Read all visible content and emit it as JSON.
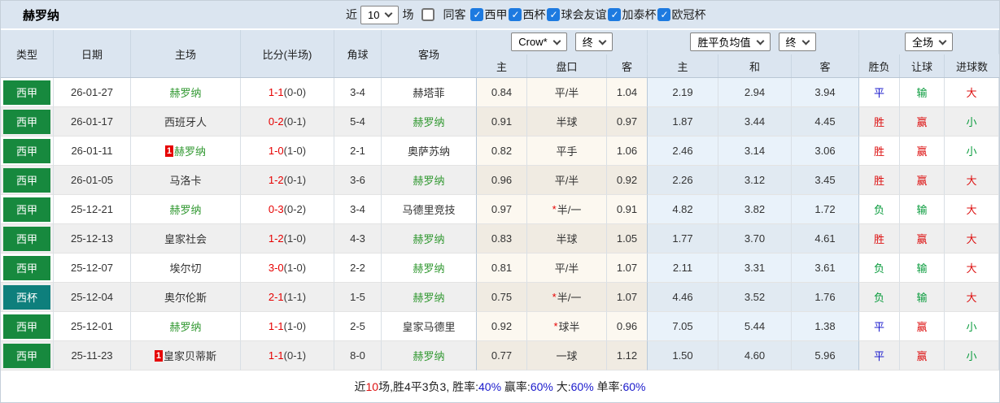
{
  "topbar": {
    "team": "赫罗纳",
    "near_label": "近",
    "games_value": "10",
    "games_unit": "场",
    "same_away": {
      "label": "同客",
      "checked": false
    },
    "filters": [
      {
        "label": "西甲",
        "checked": true
      },
      {
        "label": "西杯",
        "checked": true
      },
      {
        "label": "球会友谊",
        "checked": true
      },
      {
        "label": "加泰杯",
        "checked": true
      },
      {
        "label": "欧冠杯",
        "checked": true
      }
    ]
  },
  "selects": {
    "odds_company": "Crow*",
    "odds_stage": "终",
    "avg_label": "胜平负均值",
    "avg_stage": "终",
    "scope": "全场"
  },
  "columns": {
    "left": [
      "类型",
      "日期",
      "主场",
      "比分(半场)",
      "角球",
      "客场"
    ],
    "odds": [
      "主",
      "盘口",
      "客",
      "主",
      "和",
      "客",
      "胜负",
      "让球",
      "进球数"
    ]
  },
  "rows": [
    {
      "type": {
        "t": "西甲",
        "kind": "league"
      },
      "date": "26-01-27",
      "home": {
        "t": "赫罗纳",
        "green": true
      },
      "score": {
        "ft": "1-1",
        "ht": "(0-0)"
      },
      "corner": "3-4",
      "away": {
        "t": "赫塔菲",
        "green": false
      },
      "odds": {
        "home": "0.84",
        "star": false,
        "handicap": "平/半",
        "away": "1.04"
      },
      "avg": {
        "home": "2.19",
        "draw": "2.94",
        "away": "3.94"
      },
      "result": {
        "t": "平",
        "c": "blue"
      },
      "let": {
        "t": "输",
        "c": "green"
      },
      "goals": {
        "t": "大",
        "c": "red"
      }
    },
    {
      "type": {
        "t": "西甲",
        "kind": "league"
      },
      "date": "26-01-17",
      "home": {
        "t": "西班牙人",
        "green": false
      },
      "score": {
        "ft": "0-2",
        "ht": "(0-1)"
      },
      "corner": "5-4",
      "away": {
        "t": "赫罗纳",
        "green": true
      },
      "odds": {
        "home": "0.91",
        "star": false,
        "handicap": "半球",
        "away": "0.97"
      },
      "avg": {
        "home": "1.87",
        "draw": "3.44",
        "away": "4.45"
      },
      "result": {
        "t": "胜",
        "c": "red"
      },
      "let": {
        "t": "赢",
        "c": "red"
      },
      "goals": {
        "t": "小",
        "c": "green"
      }
    },
    {
      "type": {
        "t": "西甲",
        "kind": "league"
      },
      "date": "26-01-11",
      "home": {
        "t": "赫罗纳",
        "green": true,
        "badge": "1"
      },
      "score": {
        "ft": "1-0",
        "ht": "(1-0)"
      },
      "corner": "2-1",
      "away": {
        "t": "奥萨苏纳",
        "green": false
      },
      "odds": {
        "home": "0.82",
        "star": false,
        "handicap": "平手",
        "away": "1.06"
      },
      "avg": {
        "home": "2.46",
        "draw": "3.14",
        "away": "3.06"
      },
      "result": {
        "t": "胜",
        "c": "red"
      },
      "let": {
        "t": "赢",
        "c": "red"
      },
      "goals": {
        "t": "小",
        "c": "green"
      }
    },
    {
      "type": {
        "t": "西甲",
        "kind": "league"
      },
      "date": "26-01-05",
      "home": {
        "t": "马洛卡",
        "green": false
      },
      "score": {
        "ft": "1-2",
        "ht": "(0-1)"
      },
      "corner": "3-6",
      "away": {
        "t": "赫罗纳",
        "green": true
      },
      "odds": {
        "home": "0.96",
        "star": false,
        "handicap": "平/半",
        "away": "0.92"
      },
      "avg": {
        "home": "2.26",
        "draw": "3.12",
        "away": "3.45"
      },
      "result": {
        "t": "胜",
        "c": "red"
      },
      "let": {
        "t": "赢",
        "c": "red"
      },
      "goals": {
        "t": "大",
        "c": "red"
      }
    },
    {
      "type": {
        "t": "西甲",
        "kind": "league"
      },
      "date": "25-12-21",
      "home": {
        "t": "赫罗纳",
        "green": true
      },
      "score": {
        "ft": "0-3",
        "ht": "(0-2)"
      },
      "corner": "3-4",
      "away": {
        "t": "马德里竞技",
        "green": false
      },
      "odds": {
        "home": "0.97",
        "star": true,
        "handicap": "半/一",
        "away": "0.91"
      },
      "avg": {
        "home": "4.82",
        "draw": "3.82",
        "away": "1.72"
      },
      "result": {
        "t": "负",
        "c": "green"
      },
      "let": {
        "t": "输",
        "c": "green"
      },
      "goals": {
        "t": "大",
        "c": "red"
      }
    },
    {
      "type": {
        "t": "西甲",
        "kind": "league"
      },
      "date": "25-12-13",
      "home": {
        "t": "皇家社会",
        "green": false
      },
      "score": {
        "ft": "1-2",
        "ht": "(1-0)"
      },
      "corner": "4-3",
      "away": {
        "t": "赫罗纳",
        "green": true
      },
      "odds": {
        "home": "0.83",
        "star": false,
        "handicap": "半球",
        "away": "1.05"
      },
      "avg": {
        "home": "1.77",
        "draw": "3.70",
        "away": "4.61"
      },
      "result": {
        "t": "胜",
        "c": "red"
      },
      "let": {
        "t": "赢",
        "c": "red"
      },
      "goals": {
        "t": "大",
        "c": "red"
      }
    },
    {
      "type": {
        "t": "西甲",
        "kind": "league"
      },
      "date": "25-12-07",
      "home": {
        "t": "埃尔切",
        "green": false
      },
      "score": {
        "ft": "3-0",
        "ht": "(1-0)"
      },
      "corner": "2-2",
      "away": {
        "t": "赫罗纳",
        "green": true
      },
      "odds": {
        "home": "0.81",
        "star": false,
        "handicap": "平/半",
        "away": "1.07"
      },
      "avg": {
        "home": "2.11",
        "draw": "3.31",
        "away": "3.61"
      },
      "result": {
        "t": "负",
        "c": "green"
      },
      "let": {
        "t": "输",
        "c": "green"
      },
      "goals": {
        "t": "大",
        "c": "red"
      }
    },
    {
      "type": {
        "t": "西杯",
        "kind": "cup"
      },
      "date": "25-12-04",
      "home": {
        "t": "奥尔伦斯",
        "green": false
      },
      "score": {
        "ft": "2-1",
        "ht": "(1-1)"
      },
      "corner": "1-5",
      "away": {
        "t": "赫罗纳",
        "green": true
      },
      "odds": {
        "home": "0.75",
        "star": true,
        "handicap": "半/一",
        "away": "1.07"
      },
      "avg": {
        "home": "4.46",
        "draw": "3.52",
        "away": "1.76"
      },
      "result": {
        "t": "负",
        "c": "green"
      },
      "let": {
        "t": "输",
        "c": "green"
      },
      "goals": {
        "t": "大",
        "c": "red"
      }
    },
    {
      "type": {
        "t": "西甲",
        "kind": "league"
      },
      "date": "25-12-01",
      "home": {
        "t": "赫罗纳",
        "green": true
      },
      "score": {
        "ft": "1-1",
        "ht": "(1-0)"
      },
      "corner": "2-5",
      "away": {
        "t": "皇家马德里",
        "green": false
      },
      "odds": {
        "home": "0.92",
        "star": true,
        "handicap": "球半",
        "away": "0.96"
      },
      "avg": {
        "home": "7.05",
        "draw": "5.44",
        "away": "1.38"
      },
      "result": {
        "t": "平",
        "c": "blue"
      },
      "let": {
        "t": "赢",
        "c": "red"
      },
      "goals": {
        "t": "小",
        "c": "green"
      }
    },
    {
      "type": {
        "t": "西甲",
        "kind": "league"
      },
      "date": "25-11-23",
      "home": {
        "t": "皇家贝蒂斯",
        "green": false,
        "badge": "1"
      },
      "score": {
        "ft": "1-1",
        "ht": "(0-1)"
      },
      "corner": "8-0",
      "away": {
        "t": "赫罗纳",
        "green": true
      },
      "odds": {
        "home": "0.77",
        "star": false,
        "handicap": "一球",
        "away": "1.12"
      },
      "avg": {
        "home": "1.50",
        "draw": "4.60",
        "away": "5.96"
      },
      "result": {
        "t": "平",
        "c": "blue"
      },
      "let": {
        "t": "赢",
        "c": "red"
      },
      "goals": {
        "t": "小",
        "c": "green"
      }
    }
  ],
  "footer_parts": [
    {
      "t": "近",
      "c": "black"
    },
    {
      "t": "10",
      "c": "red"
    },
    {
      "t": "场,胜4平3负3, 胜率:",
      "c": "black"
    },
    {
      "t": "40%",
      "c": "blue"
    },
    {
      "t": " 赢率:",
      "c": "black"
    },
    {
      "t": "60%",
      "c": "blue"
    },
    {
      "t": " 大:",
      "c": "black"
    },
    {
      "t": "60%",
      "c": "blue"
    },
    {
      "t": " 单率:",
      "c": "black"
    },
    {
      "t": "60%",
      "c": "blue"
    }
  ],
  "palette": {
    "header_bg": "#dbe5f0",
    "league_badge_bg": "#17893e",
    "cup_badge_bg": "#0e7f7c",
    "win_red": "#dd1111",
    "draw_blue": "#1a1acc",
    "lose_green": "#089b3c",
    "team_green": "#339933",
    "score_red": "#e60000",
    "checkbox_blue": "#1d7ae0"
  }
}
